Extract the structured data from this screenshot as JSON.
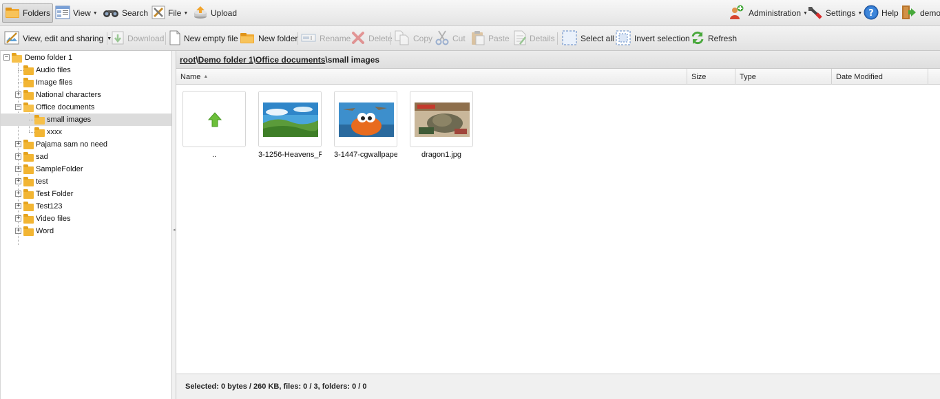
{
  "toolbar": {
    "folders": "Folders",
    "view": "View",
    "search": "Search",
    "file": "File",
    "upload": "Upload",
    "administration": "Administration",
    "settings": "Settings",
    "help": "Help",
    "user": "demo"
  },
  "actions": {
    "view_edit_sharing": "View, edit and sharing",
    "download": "Download",
    "new_empty_file": "New empty file",
    "new_folder": "New folder",
    "rename": "Rename",
    "delete": "Delete",
    "copy": "Copy",
    "cut": "Cut",
    "paste": "Paste",
    "details": "Details",
    "select_all": "Select all",
    "invert_selection": "Invert selection",
    "refresh": "Refresh"
  },
  "tree": {
    "root": "Demo folder 1",
    "items": [
      {
        "label": "Audio files"
      },
      {
        "label": "Image files"
      },
      {
        "label": "National characters"
      },
      {
        "label": "Office documents"
      },
      {
        "label": "small images"
      },
      {
        "label": "xxxx"
      },
      {
        "label": "Pajama sam no need"
      },
      {
        "label": "sad"
      },
      {
        "label": "SampleFolder"
      },
      {
        "label": "test"
      },
      {
        "label": "Test Folder"
      },
      {
        "label": "Test123"
      },
      {
        "label": "Video files"
      },
      {
        "label": "Word"
      }
    ]
  },
  "breadcrumb": {
    "parts": [
      "root",
      "Demo folder 1",
      "Office documents"
    ],
    "current": "small images",
    "separator": "\\"
  },
  "columns": [
    "Name",
    "Size",
    "Type",
    "Date Modified"
  ],
  "files": [
    {
      "name": ".."
    },
    {
      "name": "3-1256-Heavens_F"
    },
    {
      "name": "3-1447-cgwallpape"
    },
    {
      "name": "dragon1.jpg"
    }
  ],
  "status": "Selected: 0 bytes / 260 KB, files: 0 / 3, folders: 0 / 0",
  "colors": {
    "folder": "#f2b533",
    "up_arrow": "#6cbf3a"
  }
}
